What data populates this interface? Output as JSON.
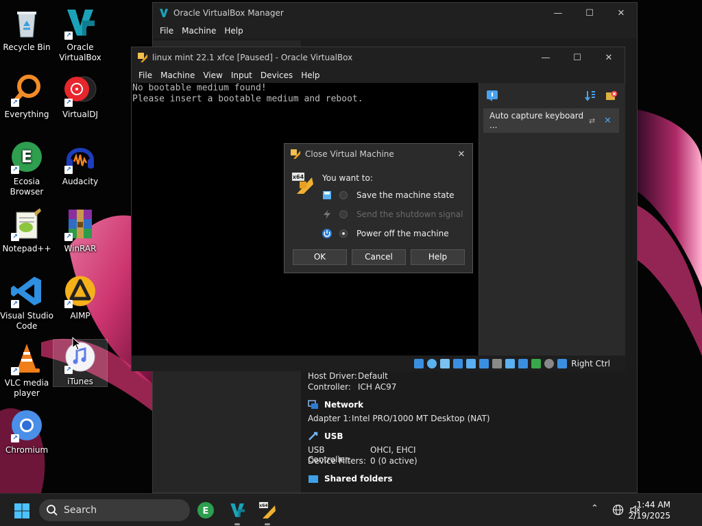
{
  "desktop": {
    "icons": [
      {
        "label": "Recycle Bin"
      },
      {
        "label": "Oracle VirtualBox"
      },
      {
        "label": "Everything"
      },
      {
        "label": "VirtualDJ"
      },
      {
        "label": "Ecosia Browser"
      },
      {
        "label": "Audacity"
      },
      {
        "label": "Notepad++"
      },
      {
        "label": "WinRAR"
      },
      {
        "label": "Visual Studio Code"
      },
      {
        "label": "AIMP"
      },
      {
        "label": "VLC media player"
      },
      {
        "label": "iTunes"
      },
      {
        "label": "Chromium"
      }
    ]
  },
  "manager": {
    "title": "Oracle VirtualBox Manager",
    "menu": [
      "File",
      "Machine",
      "Help"
    ],
    "details": {
      "audio_rows": [
        {
          "key": "Host Driver:",
          "value": "Default"
        },
        {
          "key": "Controller:",
          "value": "ICH AC97"
        }
      ],
      "network": {
        "heading": "Network",
        "rows": [
          {
            "key": "Adapter 1:",
            "value": "Intel PRO/1000 MT Desktop (NAT)"
          }
        ]
      },
      "usb": {
        "heading": "USB",
        "rows": [
          {
            "key": "USB Controller:",
            "value": "OHCI, EHCI"
          },
          {
            "key": "Device Filters:",
            "value": "0 (0 active)"
          }
        ]
      },
      "shared": {
        "heading": "Shared folders"
      }
    }
  },
  "vm": {
    "title": "linux mint 22.1 xfce [Paused] - Oracle VirtualBox",
    "menu": [
      "File",
      "Machine",
      "View",
      "Input",
      "Devices",
      "Help"
    ],
    "console_lines": [
      "No bootable medium found!",
      "Please insert a bootable medium and reboot."
    ],
    "notification": "Auto capture keyboard ...",
    "host_key": "Right Ctrl"
  },
  "dialog": {
    "title": "Close Virtual Machine",
    "prompt": "You want to:",
    "options": [
      {
        "label": "Save the machine state",
        "selected": false,
        "enabled": true
      },
      {
        "label": "Send the shutdown signal",
        "selected": false,
        "enabled": false
      },
      {
        "label": "Power off the machine",
        "selected": true,
        "enabled": true
      }
    ],
    "buttons": {
      "ok": "OK",
      "cancel": "Cancel",
      "help": "Help"
    }
  },
  "taskbar": {
    "search_label": "Search",
    "time": "1:44 AM",
    "date": "2/19/2025"
  },
  "colors": {
    "accent_blue": "#1a73e8",
    "vbox_blue": "#2b7bd6"
  }
}
